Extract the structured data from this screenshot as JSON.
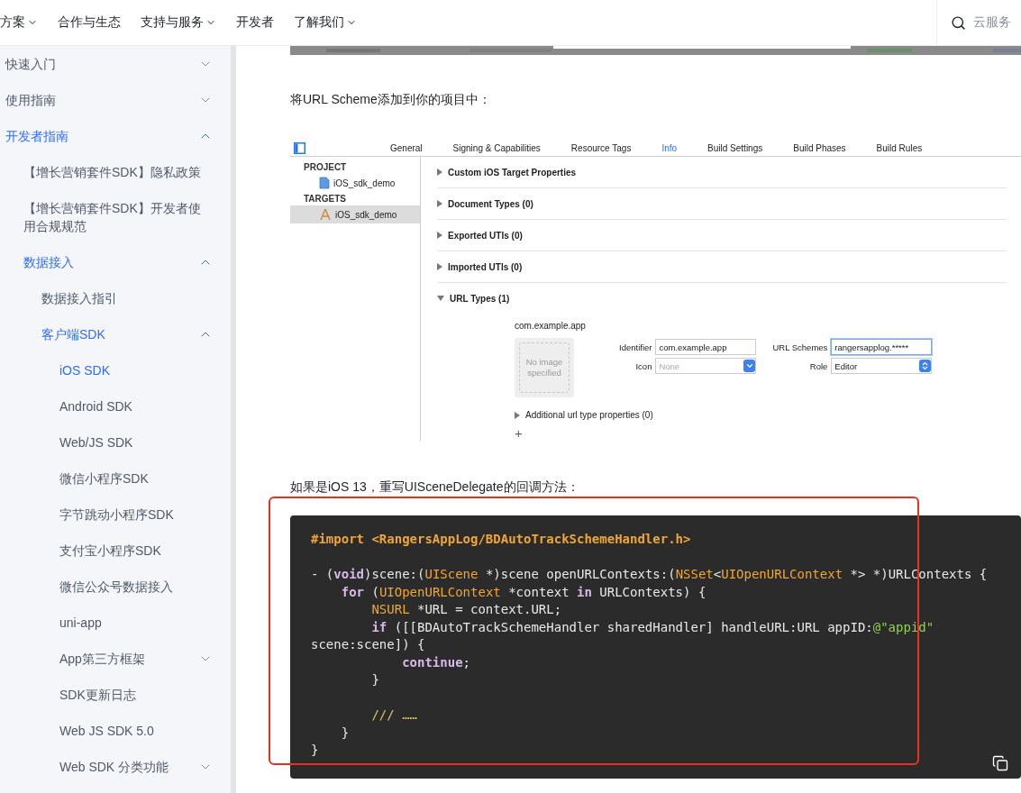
{
  "nav": {
    "items": [
      {
        "label": "方案",
        "has_menu": true
      },
      {
        "label": "合作与生态",
        "has_menu": false
      },
      {
        "label": "支持与服务",
        "has_menu": true
      },
      {
        "label": "开发者",
        "has_menu": false
      },
      {
        "label": "了解我们",
        "has_menu": true
      }
    ],
    "search": {
      "placeholder": "云服务"
    }
  },
  "sidebar": {
    "items": [
      {
        "label": "快速入门",
        "expandable": true,
        "expanded": false,
        "selected": false
      },
      {
        "label": "使用指南",
        "expandable": true,
        "expanded": false,
        "selected": false
      },
      {
        "label": "开发者指南",
        "expandable": true,
        "expanded": true,
        "children": [
          {
            "label": "【增长营销套件SDK】隐私政策",
            "expandable": false,
            "expanded": false,
            "selected": false
          },
          {
            "label": "【增长营销套件SDK】开发者使用合规规范",
            "expandable": false,
            "expanded": false,
            "selected": false
          },
          {
            "label": "数据接入",
            "expandable": true,
            "expanded": true,
            "children": [
              {
                "label": "数据接入指引",
                "expandable": false,
                "expanded": false,
                "selected": false
              },
              {
                "label": "客户端SDK",
                "expandable": true,
                "expanded": true,
                "children": [
                  {
                    "label": "iOS SDK",
                    "expandable": false,
                    "expanded": false,
                    "selected": true
                  },
                  {
                    "label": "Android SDK",
                    "expandable": false,
                    "expanded": false,
                    "selected": false
                  },
                  {
                    "label": "Web/JS SDK",
                    "expandable": false,
                    "expanded": false,
                    "selected": false
                  },
                  {
                    "label": "微信小程序SDK",
                    "expandable": false,
                    "expanded": false,
                    "selected": false
                  },
                  {
                    "label": "字节跳动小程序SDK",
                    "expandable": false,
                    "expanded": false,
                    "selected": false
                  },
                  {
                    "label": "支付宝小程序SDK",
                    "expandable": false,
                    "expanded": false,
                    "selected": false
                  },
                  {
                    "label": "微信公众号数据接入",
                    "expandable": false,
                    "expanded": false,
                    "selected": false
                  },
                  {
                    "label": "uni-app",
                    "expandable": false,
                    "expanded": false,
                    "selected": false
                  },
                  {
                    "label": "App第三方框架",
                    "expandable": true,
                    "expanded": false,
                    "selected": false
                  },
                  {
                    "label": "SDK更新日志",
                    "expandable": false,
                    "expanded": false,
                    "selected": false
                  },
                  {
                    "label": "Web JS SDK 5.0",
                    "expandable": false,
                    "expanded": false,
                    "selected": false
                  },
                  {
                    "label": "Web SDK 分类功能",
                    "expandable": true,
                    "expanded": false,
                    "selected": false
                  }
                ]
              }
            ]
          }
        ]
      }
    ]
  },
  "article": {
    "paragraph_1": "将URL Scheme添加到你的项目中：",
    "xcode": {
      "tabs": [
        {
          "label": "General",
          "selected": false
        },
        {
          "label": "Signing & Capabilities",
          "selected": false
        },
        {
          "label": "Resource Tags",
          "selected": false
        },
        {
          "label": "Info",
          "selected": true
        },
        {
          "label": "Build Settings",
          "selected": false
        },
        {
          "label": "Build Phases",
          "selected": false
        },
        {
          "label": "Build Rules",
          "selected": false
        }
      ],
      "groups": [
        {
          "heading": "PROJECT",
          "items": [
            {
              "label": "iOS_sdk_demo",
              "kind": "project",
              "selected": false
            }
          ]
        },
        {
          "heading": "TARGETS",
          "items": [
            {
              "label": "iOS_sdk_demo",
              "kind": "target",
              "selected": true
            }
          ]
        }
      ],
      "sections": [
        {
          "title": "Custom iOS Target Properties",
          "expanded": false
        },
        {
          "title": "Document Types (0)",
          "expanded": false
        },
        {
          "title": "Exported UTIs (0)",
          "expanded": false
        },
        {
          "title": "Imported UTIs (0)",
          "expanded": false
        },
        {
          "title": "URL Types (1)",
          "expanded": true
        }
      ],
      "url_type": {
        "name": "com.example.app",
        "image_note": "No image specified",
        "identifier_label": "Identifier",
        "identifier": "com.example.app",
        "icon_label": "Icon",
        "icon_placeholder": "None",
        "schemes_label": "URL Schemes",
        "schemes": "rangersapplog.*****",
        "role_label": "Role",
        "role": "Editor",
        "additional": "Additional url type properties (0)",
        "add": "+"
      }
    },
    "paragraph_2": "如果是iOS 13，重写UISceneDelegate的回调方法：",
    "code": {
      "highlighted": true,
      "lines": [
        {
          "kind": "code",
          "tokens": [
            {
              "text": "#import <RangersAppLog/BDAutoTrackSchemeHandler.h>",
              "kind": "directive"
            }
          ]
        },
        {
          "kind": "blank"
        },
        {
          "kind": "code",
          "tokens": [
            {
              "text": "- (",
              "kind": "plain"
            },
            {
              "text": "void",
              "kind": "keyword"
            },
            {
              "text": ")scene:(",
              "kind": "plain"
            },
            {
              "text": "UIScene",
              "kind": "type"
            },
            {
              "text": " *)scene openURLContexts:(",
              "kind": "plain"
            },
            {
              "text": "NSSet",
              "kind": "type"
            },
            {
              "text": "<",
              "kind": "plain"
            },
            {
              "text": "UIOpenURLContext",
              "kind": "type"
            },
            {
              "text": " *> *)URLContexts {",
              "kind": "plain"
            }
          ]
        },
        {
          "kind": "code",
          "tokens": [
            {
              "text": "    for",
              "kind": "keyword"
            },
            {
              "text": " (",
              "kind": "plain"
            },
            {
              "text": "UIOpenURLContext",
              "kind": "type"
            },
            {
              "text": " *context ",
              "kind": "plain"
            },
            {
              "text": "in",
              "kind": "keyword"
            },
            {
              "text": " URLContexts) {",
              "kind": "plain"
            }
          ]
        },
        {
          "kind": "code",
          "tokens": [
            {
              "text": "        NSURL",
              "kind": "type"
            },
            {
              "text": " *URL = context.URL;",
              "kind": "plain"
            }
          ]
        },
        {
          "kind": "code",
          "tokens": [
            {
              "text": "        if",
              "kind": "keyword"
            },
            {
              "text": " ([[BDAutoTrackSchemeHandler sharedHandler] handleURL:URL appID:",
              "kind": "plain"
            },
            {
              "text": "@\"appid\"",
              "kind": "string"
            }
          ]
        },
        {
          "kind": "code",
          "tokens": [
            {
              "text": "scene:scene]) {",
              "kind": "plain"
            }
          ]
        },
        {
          "kind": "code",
          "tokens": [
            {
              "text": "            continue",
              "kind": "keyword"
            },
            {
              "text": ";",
              "kind": "plain"
            }
          ]
        },
        {
          "kind": "code",
          "tokens": [
            {
              "text": "        }",
              "kind": "plain"
            }
          ]
        },
        {
          "kind": "blank"
        },
        {
          "kind": "code",
          "tokens": [
            {
              "text": "        /// ……",
              "kind": "comment"
            }
          ]
        },
        {
          "kind": "code",
          "tokens": [
            {
              "text": "    }",
              "kind": "plain"
            }
          ]
        },
        {
          "kind": "code",
          "tokens": [
            {
              "text": "}",
              "kind": "plain"
            }
          ]
        }
      ]
    }
  }
}
